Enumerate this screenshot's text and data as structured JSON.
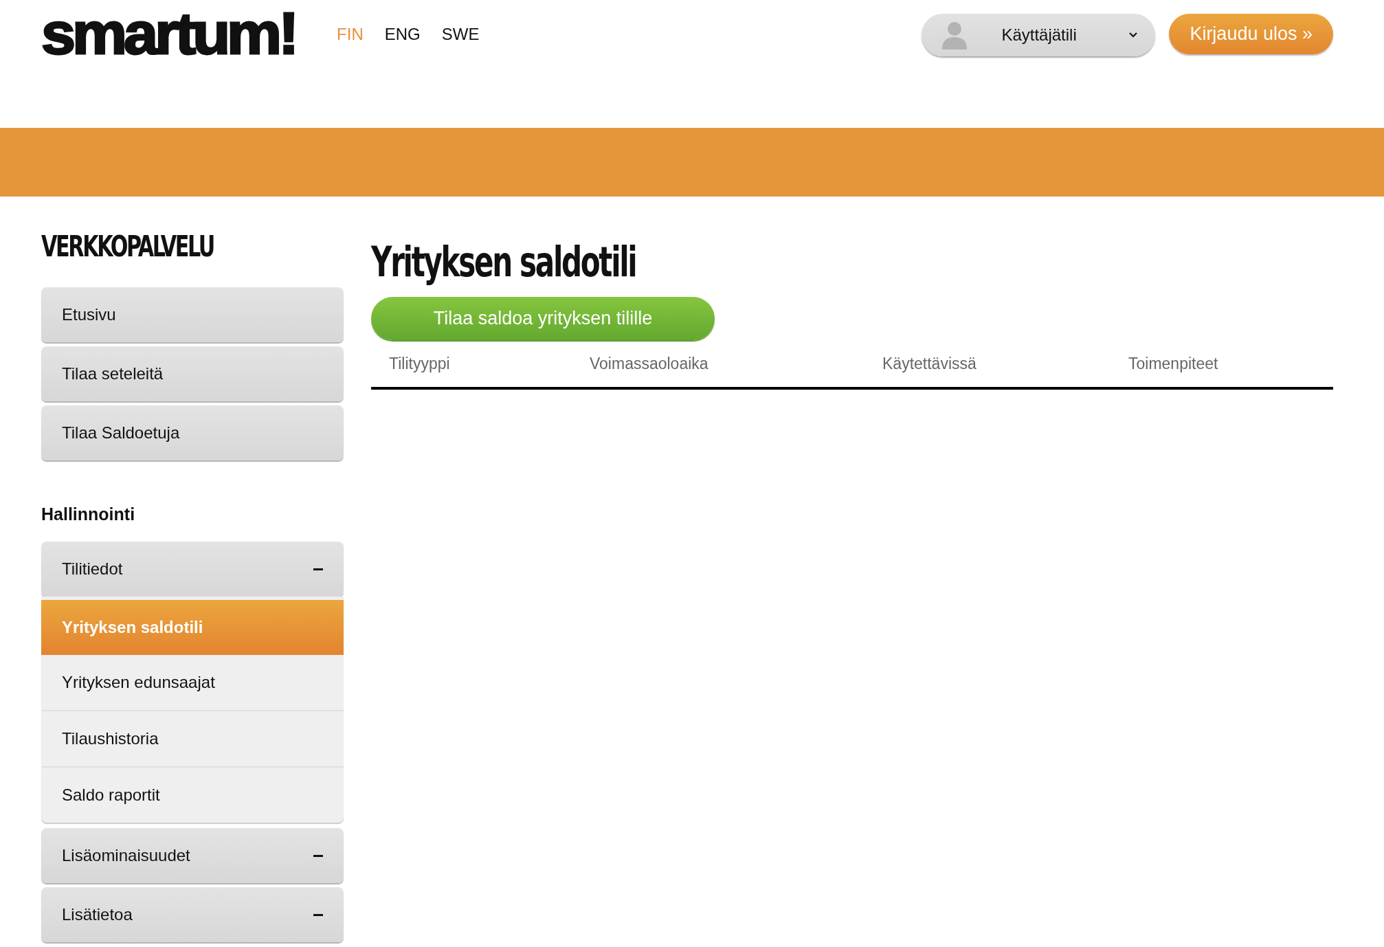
{
  "header": {
    "logo": "smartum!",
    "languages": [
      {
        "label": "FIN",
        "selected": true
      },
      {
        "label": "ENG",
        "selected": false
      },
      {
        "label": "SWE",
        "selected": false
      }
    ],
    "account_menu": {
      "label": "Käyttäjätili"
    },
    "logout_button": "Kirjaudu ulos »"
  },
  "sidebar": {
    "title": "VERKKOPALVELU",
    "items": [
      {
        "label": "Etusivu"
      },
      {
        "label": "Tilaa seteleitä"
      },
      {
        "label": "Tilaa Saldoetuja"
      }
    ],
    "section_heading": "Hallinnointi",
    "groups": [
      {
        "label": "Tilitiedot",
        "children": [
          {
            "label": "Yrityksen saldotili",
            "selected": true
          },
          {
            "label": "Yrityksen edunsaajat",
            "selected": false
          },
          {
            "label": "Tilaushistoria",
            "selected": false
          },
          {
            "label": "Saldo raportit",
            "selected": false
          }
        ]
      },
      {
        "label": "Lisäominaisuudet"
      },
      {
        "label": "Lisätietoa"
      }
    ]
  },
  "main": {
    "title": "Yrityksen saldotili",
    "order_button": "Tilaa saldoa yrityksen tilille",
    "table": {
      "columns": [
        "Tilityyppi",
        "Voimassaoloaika",
        "Käytettävissä",
        "Toimenpiteet"
      ]
    }
  }
}
